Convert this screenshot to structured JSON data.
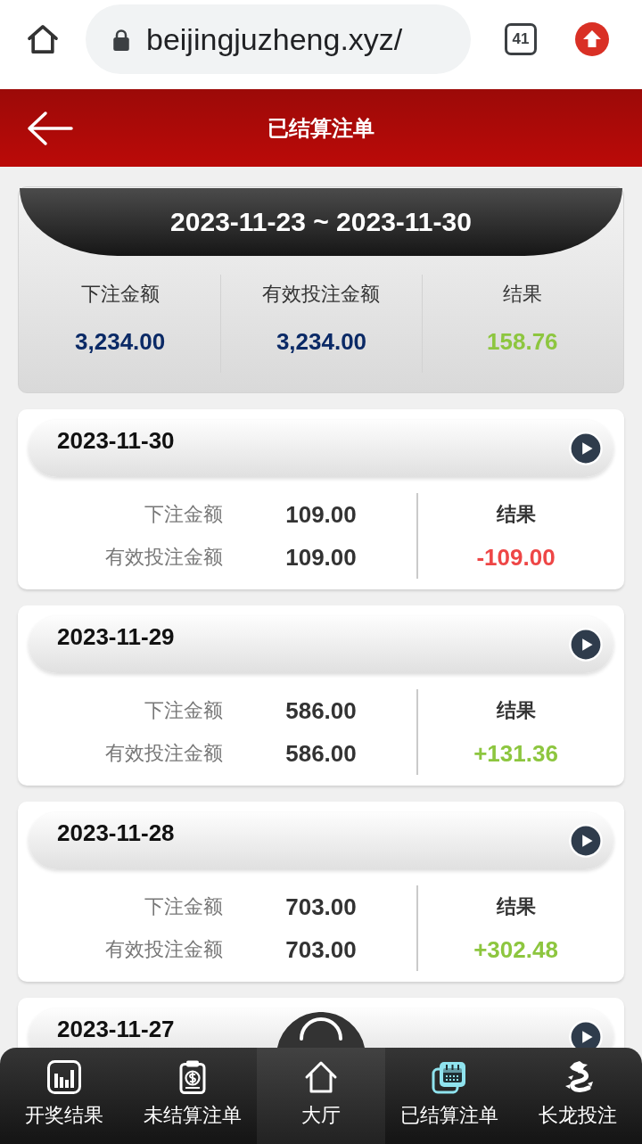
{
  "browser": {
    "url": "beijingjuzheng.xyz/",
    "tab_count": "41"
  },
  "header": {
    "title": "已结算注单"
  },
  "summary": {
    "date_range": "2023-11-23 ~ 2023-11-30",
    "stats": [
      {
        "label": "下注金额",
        "value": "3,234.00",
        "color": "#0b2a66"
      },
      {
        "label": "有效投注金额",
        "value": "3,234.00",
        "color": "#0b2a66"
      },
      {
        "label": "结果",
        "value": "158.76",
        "color": "#8dc63f"
      }
    ]
  },
  "days": [
    {
      "date": "2023-11-30",
      "rows": [
        {
          "label": "下注金额",
          "value": "109.00"
        },
        {
          "label": "有效投注金额",
          "value": "109.00"
        }
      ],
      "result_label": "结果",
      "result": "-109.00",
      "color": "#ee4646"
    },
    {
      "date": "2023-11-29",
      "rows": [
        {
          "label": "下注金额",
          "value": "586.00"
        },
        {
          "label": "有效投注金额",
          "value": "586.00"
        }
      ],
      "result_label": "结果",
      "result": "+131.36",
      "color": "#8dc63f"
    },
    {
      "date": "2023-11-28",
      "rows": [
        {
          "label": "下注金额",
          "value": "703.00"
        },
        {
          "label": "有效投注金额",
          "value": "703.00"
        }
      ],
      "result_label": "结果",
      "result": "+302.48",
      "color": "#8dc63f"
    },
    {
      "date": "2023-11-27"
    }
  ],
  "nav": [
    {
      "label": "开奖结果",
      "kind": "chart",
      "selected": false
    },
    {
      "label": "未结算注单",
      "kind": "clipboard",
      "selected": false
    },
    {
      "label": "大厅",
      "kind": "home",
      "selected": false
    },
    {
      "label": "已结算注单",
      "kind": "ticket",
      "selected": true
    },
    {
      "label": "长龙投注",
      "kind": "dragon",
      "selected": false
    }
  ]
}
